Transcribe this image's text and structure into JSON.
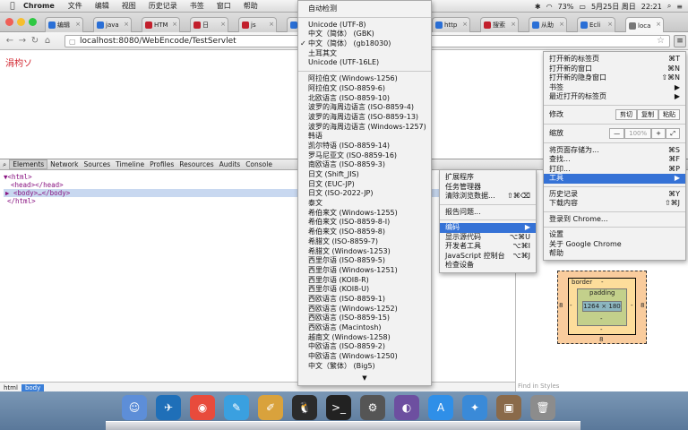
{
  "menubar": {
    "app": "Chrome",
    "menus": [
      "文件",
      "编辑",
      "视图",
      "历史记录",
      "书签",
      "窗口",
      "帮助"
    ],
    "battery": "73%",
    "date": "5月25日 周日",
    "time": "22:21"
  },
  "tabs": [
    {
      "label": "编辑",
      "color": "#2a6fd6"
    },
    {
      "label": "java",
      "color": "#2a6fd6"
    },
    {
      "label": "HTM",
      "color": "#c21f2c"
    },
    {
      "label": "日",
      "color": "#c21f2c"
    },
    {
      "label": "js",
      "color": "#c21f2c"
    },
    {
      "label": "java",
      "color": "#2a6fd6"
    },
    {
      "label": "HT",
      "color": "#c21f2c"
    },
    {
      "label": "讨论",
      "color": "#2a6fd6"
    },
    {
      "label": "http",
      "color": "#2a6fd6"
    },
    {
      "label": "搜索",
      "color": "#c21f2c"
    },
    {
      "label": "从助",
      "color": "#2a6fd6"
    },
    {
      "label": "Ecli",
      "color": "#2a6fd6"
    },
    {
      "label": "loca",
      "color": "#777777"
    }
  ],
  "address": {
    "url": "localhost:8080/WebEncode/TestServlet"
  },
  "page": {
    "text": "涓枃ソ"
  },
  "devtools": {
    "tabs": [
      "Elements",
      "Network",
      "Sources",
      "Timeline",
      "Profiles",
      "Resources",
      "Audits",
      "Console"
    ],
    "tree": [
      "▼<html>",
      "<head></head>",
      "▶ <body>…</body>",
      "</html>"
    ],
    "crumbs": [
      "html",
      "body"
    ],
    "find": "Find in Styles",
    "box": {
      "border": "border",
      "padding": "padding",
      "content": "1264 × 180",
      "margin_left": "8",
      "margin_right": "8",
      "margin_bottom": "8",
      "dash": "-"
    }
  },
  "encoding_menu": {
    "auto": "自动检测",
    "group1": [
      "Unicode (UTF-8)",
      "中文（简体） (GBK)",
      "中文（简体） (gb18030)",
      "土耳其文",
      "Unicode (UTF-16LE)"
    ],
    "checked_index": 1,
    "group2": [
      "阿拉伯文 (Windows-1256)",
      "阿拉伯文 (ISO-8859-6)",
      "北欧语言 (ISO-8859-10)",
      "波罗的海周边语言 (ISO-8859-4)",
      "波罗的海周边语言 (ISO-8859-13)",
      "波罗的海周边语言 (Windows-1257)",
      "韩语",
      "凯尔特语 (ISO-8859-14)",
      "罗马尼亚文 (ISO-8859-16)",
      "南欧语言 (ISO-8859-3)",
      "日文 (Shift_JIS)",
      "日文 (EUC-JP)",
      "日文 (ISO-2022-JP)",
      "泰文",
      "希伯来文 (Windows-1255)",
      "希伯来文 (ISO-8859-8-I)",
      "希伯来文 (ISO-8859-8)",
      "希腊文 (ISO-8859-7)",
      "希腊文 (Windows-1253)",
      "西里尔语 (ISO-8859-5)",
      "西里尔语 (Windows-1251)",
      "西里尔语 (KOI8-R)",
      "西里尔语 (KOI8-U)",
      "西欧语言 (ISO-8859-1)",
      "西欧语言 (Windows-1252)",
      "西欧语言 (ISO-8859-15)",
      "西欧语言 (Macintosh)",
      "越南文 (Windows-1258)",
      "中欧语言 (ISO-8859-2)",
      "中欧语言 (Windows-1250)",
      "中文（繁体） (Big5)"
    ],
    "more": "▼"
  },
  "tools_menu": {
    "items": [
      {
        "label": "扩展程序",
        "shortcut": ""
      },
      {
        "label": "任务管理器",
        "shortcut": ""
      },
      {
        "label": "清除浏览数据...",
        "shortcut": "⇧⌘⌫"
      },
      {
        "sep": true
      },
      {
        "label": "报告问题...",
        "shortcut": ""
      },
      {
        "sep": true
      },
      {
        "label": "编码",
        "shortcut": "▶",
        "hl": true
      },
      {
        "label": "显示源代码",
        "shortcut": "⌥⌘U"
      },
      {
        "label": "开发者工具",
        "shortcut": "⌥⌘I"
      },
      {
        "label": "JavaScript 控制台",
        "shortcut": "⌥⌘J"
      },
      {
        "label": "检查设备",
        "shortcut": ""
      }
    ]
  },
  "chrome_menu": {
    "items": [
      {
        "label": "打开新的标签页",
        "shortcut": "⌘T"
      },
      {
        "label": "打开新的窗口",
        "shortcut": "⌘N"
      },
      {
        "label": "打开新的隐身窗口",
        "shortcut": "⇧⌘N"
      },
      {
        "label": "书签",
        "shortcut": "▶"
      },
      {
        "label": "最近打开的标签页",
        "shortcut": "▶"
      }
    ],
    "edit": {
      "label": "修改",
      "cut": "剪切",
      "copy": "复制",
      "paste": "粘贴"
    },
    "zoom": {
      "label": "缩放",
      "minus": "—",
      "value": "100%",
      "plus": "+",
      "full": "⤢"
    },
    "items2": [
      {
        "label": "将页面存储为...",
        "shortcut": "⌘S"
      },
      {
        "label": "查找...",
        "shortcut": "⌘F"
      },
      {
        "label": "打印...",
        "shortcut": "⌘P"
      },
      {
        "label": "工具",
        "shortcut": "▶",
        "hl": true
      }
    ],
    "items3": [
      {
        "label": "历史记录",
        "shortcut": "⌘Y"
      },
      {
        "label": "下载内容",
        "shortcut": "⇧⌘J"
      }
    ],
    "signin": "登录到 Chrome...",
    "items4": [
      "设置",
      "关于 Google Chrome",
      "帮助"
    ]
  },
  "dock": [
    "finder-icon",
    "bird-icon",
    "chrome-icon",
    "pen-icon",
    "notes-icon",
    "qq-icon",
    "terminal-icon",
    "app-icon",
    "eclipse-icon",
    "appstore-icon",
    "safari-icon",
    "photo-icon",
    "trash-icon"
  ]
}
